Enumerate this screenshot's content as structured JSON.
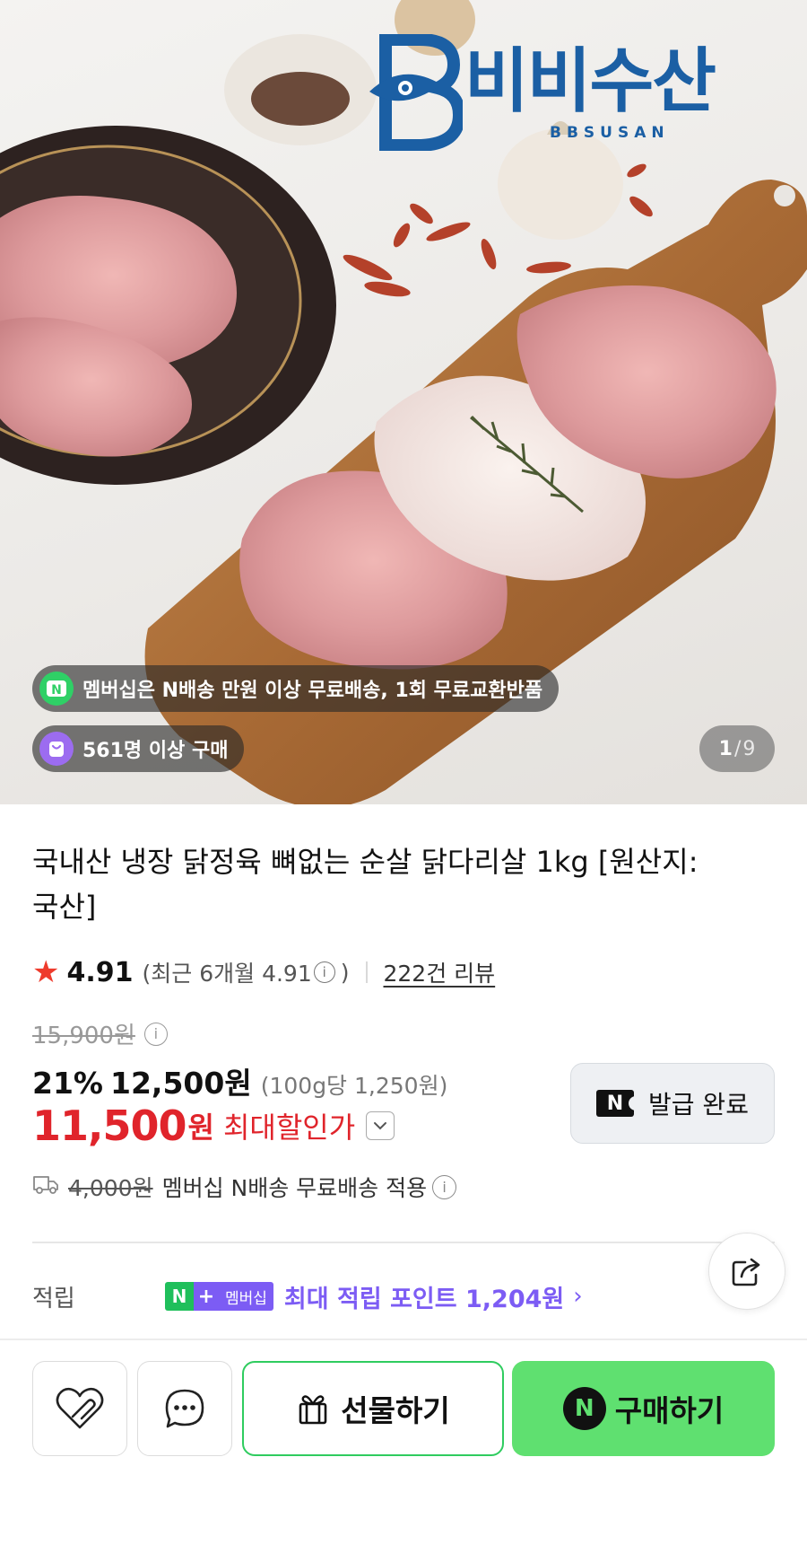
{
  "hero": {
    "brand_name": "비비수산",
    "brand_sub": "BBSUSAN",
    "membership_banner": "멤버십은 N배송 만원 이상 무료배송, 1회 무료교환반품",
    "purchase_badge": "561명 이상 구매",
    "image_counter": {
      "current": "1",
      "separator": "/",
      "total": "9"
    }
  },
  "product": {
    "title": "국내산 냉장 닭정육 뼈없는 순살 닭다리살 1kg [원산지:국산]"
  },
  "rating": {
    "score": "4.91",
    "recent_prefix": "(최근 6개월 4.91",
    "recent_suffix": ")",
    "info_glyph": "i",
    "reviews": "222건 리뷰"
  },
  "price": {
    "original": "15,900원",
    "discount_rate": "21%",
    "sale_price": "12,500원",
    "unit_price": "(100g당 1,250원)",
    "max_discount_amount": "11,500",
    "max_discount_won": "원",
    "max_discount_label": "최대할인가",
    "coupon_button": "발급 완료",
    "coupon_logo": "N"
  },
  "shipping": {
    "original_fee": "4,000원",
    "text": "멤버십 N배송 무료배송 적용"
  },
  "points": {
    "label": "적립",
    "badge_n": "N",
    "badge_plus": "+",
    "badge_member": "멤버십",
    "text": "최대 적립 포인트 1,204원",
    "arrow": "›"
  },
  "bottom_bar": {
    "gift_label": "선물하기",
    "buy_label": "구매하기",
    "buy_logo": "N"
  },
  "colors": {
    "accent_red": "#e0242b",
    "membership_purple": "#7c5cf4",
    "naver_green": "#5fe070",
    "brand_blue": "#1b5fa4",
    "star": "#ee3b2c"
  }
}
